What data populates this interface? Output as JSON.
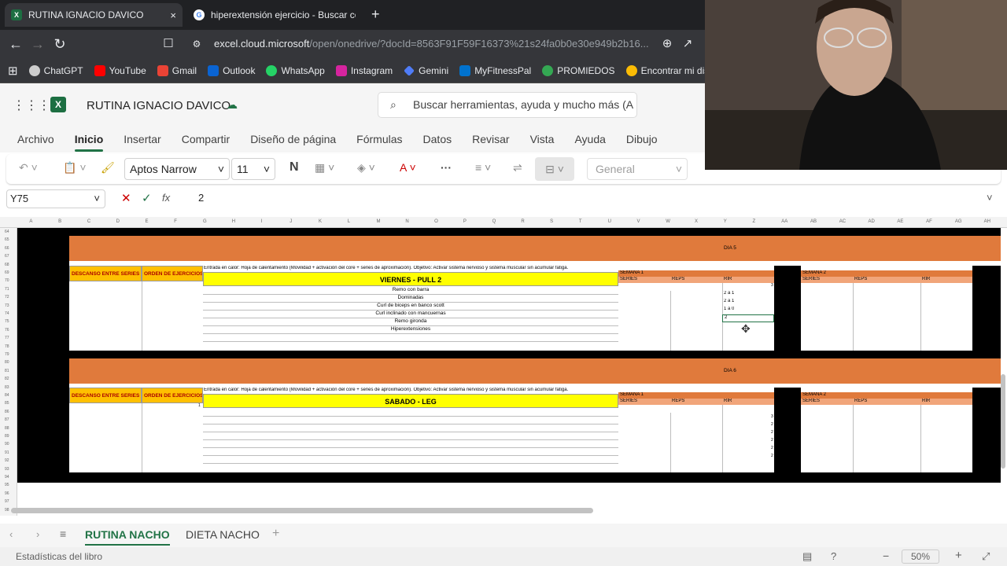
{
  "browser": {
    "tabs": [
      {
        "title": "RUTINA IGNACIO DAVICO",
        "close": "×"
      },
      {
        "title": "hiperextensión ejercicio - Buscar con"
      }
    ],
    "new_tab": "+",
    "url_host": "excel.cloud.microsoft",
    "url_path": "/open/onedrive/?docId=8563F91F59F16373%21s24fa0b0e30e949b2b16...",
    "bookmarks": [
      "ChatGPT",
      "YouTube",
      "Gmail",
      "Outlook",
      "WhatsApp",
      "Instagram",
      "Gemini",
      "MyFitnessPal",
      "PROMIEDOS",
      "Encontrar mi dis"
    ]
  },
  "excel": {
    "doc_name": "RUTINA IGNACIO DAVICO",
    "search_placeholder": "Buscar herramientas, ayuda y mucho más (A",
    "menu": [
      "Archivo",
      "Inicio",
      "Insertar",
      "Compartir",
      "Diseño de página",
      "Fórmulas",
      "Datos",
      "Revisar",
      "Vista",
      "Ayuda",
      "Dibujo"
    ],
    "active_menu": "Inicio",
    "font_name": "Aptos Narrow",
    "font_size": "11",
    "bold_label": "N",
    "number_format": "General",
    "name_box": "Y75",
    "fx": "fx",
    "formula_value": "2",
    "sheet_tabs": [
      "RUTINA NACHO",
      "DIETA NACHO"
    ],
    "active_sheet": "RUTINA NACHO",
    "status_left": "Estadísticas del libro",
    "zoom": "50%"
  },
  "sheet": {
    "col_headers": [
      "A",
      "B",
      "C",
      "D",
      "E",
      "F",
      "G",
      "H",
      "I",
      "J",
      "K",
      "L",
      "M",
      "N",
      "O",
      "P",
      "Q",
      "R",
      "S",
      "T",
      "U",
      "V",
      "W",
      "X",
      "Y",
      "Z",
      "AA",
      "AB",
      "AC",
      "AD",
      "AE",
      "AF",
      "AG",
      "AH"
    ],
    "row_numbers": [
      "64",
      "65",
      "66",
      "67",
      "68",
      "69",
      "70",
      "71",
      "72",
      "73",
      "74",
      "75",
      "76",
      "77",
      "78",
      "79",
      "80",
      "81",
      "82",
      "83",
      "84",
      "85",
      "86",
      "87",
      "88",
      "89",
      "90",
      "91",
      "92",
      "93",
      "94",
      "95",
      "96",
      "97",
      "98"
    ],
    "day5": {
      "banner": "DIA 5",
      "descanso": "DESCANSO ENTRE SERIES",
      "orden": "ORDEN DE EJERCICIOS",
      "intro": "Entrada en calor: Hoja de calentamiento (Movilidad + activación del core + series de aproximación). Objetivo: Activar sistema nervioso y sistema muscular sin acumular fatiga.",
      "title": "VIERNES - PULL 2",
      "exercises": [
        "Remo con barra",
        "Dominadas",
        "Curl de biceps en banco scott",
        "Curl inclinado con mancuernas",
        "Remo gironda",
        "Hiperextensiones"
      ],
      "semana1": "SEMANA 1",
      "semana2": "SEMANA 2",
      "series": "SERIES",
      "reps": "REPS",
      "rir": "RIR",
      "rir_values": [
        "",
        "2 a 1",
        "2 a 1",
        "1 a 0",
        "2"
      ],
      "right_val": "3"
    },
    "day6": {
      "banner": "DIA 6",
      "descanso": "DESCANSO ENTRE SERIES",
      "orden": "ORDEN DE EJERCICIOS",
      "intro": "Entrada en calor: Hoja de calentamiento (Movilidad + activación del core + series de aproximación). Objetivo: Activar sistema nervioso y sistema muscular sin acumular fatiga.",
      "title": "SABADO - LEG",
      "orden_val": "1",
      "semana1": "SEMANA 1",
      "semana2": "SEMANA 2",
      "series": "SERIES",
      "reps": "REPS",
      "rir": "RIR",
      "right_vals": [
        "3",
        "2",
        "2",
        "2",
        "2",
        "2"
      ]
    }
  }
}
